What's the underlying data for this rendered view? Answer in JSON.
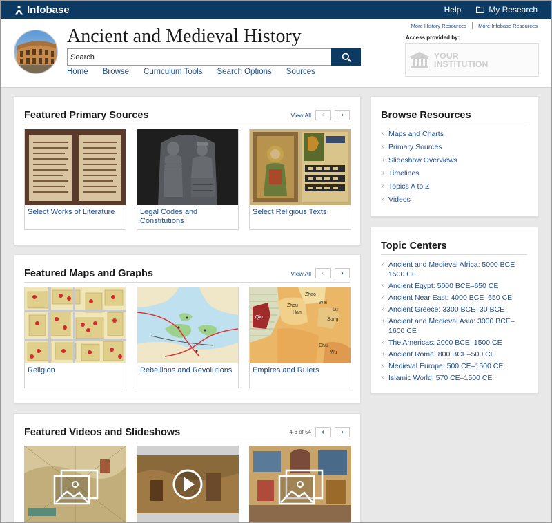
{
  "topbar": {
    "brand": "Infobase",
    "help": "Help",
    "my_research": "My Research"
  },
  "header": {
    "title": "Ancient and Medieval History",
    "search_placeholder": "Search",
    "nav": [
      "Home",
      "Browse",
      "Curriculum Tools",
      "Search Options",
      "Sources"
    ],
    "resource_links": [
      "More History Resources",
      "More Infobase Resources"
    ],
    "access_label": "Access provided by:",
    "institution_line1": "YOUR",
    "institution_line2": "INSTITUTION"
  },
  "primary_sources": {
    "title": "Featured Primary Sources",
    "view_all": "View All",
    "prev": "‹",
    "next": "›",
    "items": [
      {
        "label": "Select Works of Literature",
        "image": "manuscript-image"
      },
      {
        "label": "Legal Codes and Constitutions",
        "image": "stele-image"
      },
      {
        "label": "Select Religious Texts",
        "image": "illuminated-manuscript-image"
      }
    ]
  },
  "maps_graphs": {
    "title": "Featured Maps and Graphs",
    "view_all": "View All",
    "prev": "‹",
    "next": "›",
    "items": [
      {
        "label": "Religion",
        "image": "temple-plan-map"
      },
      {
        "label": "Rebellions and Revolutions",
        "image": "mediterranean-routes-map"
      },
      {
        "label": "Empires and Rulers",
        "image": "china-states-map"
      }
    ],
    "map_place_names": [
      "Qin",
      "Zhao",
      "Wei",
      "Lu",
      "Song",
      "Han",
      "Zhou",
      "Wu",
      "Chu"
    ]
  },
  "videos": {
    "title": "Featured Videos and Slideshows",
    "count": "4-6 of 54",
    "prev": "‹",
    "next": "›",
    "items": [
      {
        "type": "slideshow",
        "icon": "slideshow-icon"
      },
      {
        "type": "video",
        "icon": "play-icon"
      },
      {
        "type": "slideshow",
        "icon": "slideshow-icon"
      }
    ]
  },
  "browse": {
    "title": "Browse Resources",
    "items": [
      "Maps and Charts",
      "Primary Sources",
      "Slideshow Overviews",
      "Timelines",
      "Topics A to Z",
      "Videos"
    ]
  },
  "topics": {
    "title": "Topic Centers",
    "items": [
      "Ancient and Medieval Africa: 5000 BCE–1500 CE",
      "Ancient Egypt: 5000 BCE–650 CE",
      "Ancient Near East: 4000 BCE–650 CE",
      "Ancient Greece: 3300 BCE–30 BCE",
      "Ancient and Medieval Asia: 3000 BCE–1600 CE",
      "The Americas: 2000 BCE–1500 CE",
      "Ancient Rome: 800 BCE–500 CE",
      "Medieval Europe: 500 CE–1500 CE",
      "Islamic World: 570 CE–1500 CE"
    ]
  },
  "colors": {
    "navy": "#0d3a63",
    "link": "#1f4f8e",
    "page_bg": "#e8e8e8"
  }
}
